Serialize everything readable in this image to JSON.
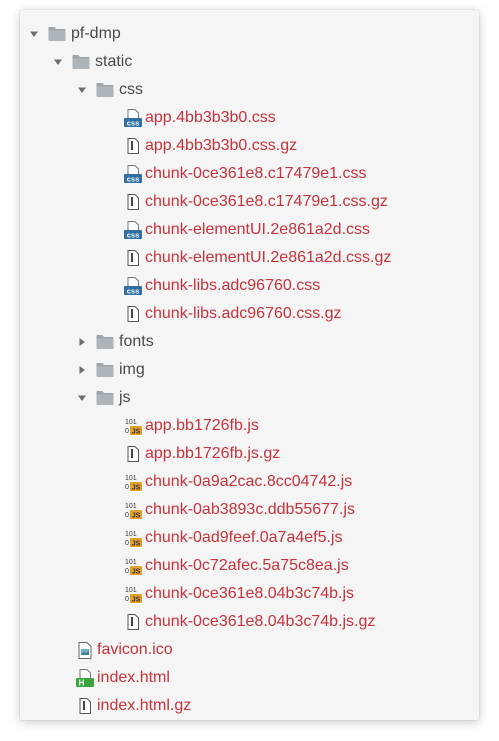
{
  "tree": {
    "root": {
      "label": "pf-dmp",
      "expanded": true
    },
    "static": {
      "label": "static",
      "expanded": true
    },
    "css": {
      "label": "css",
      "expanded": true,
      "files": [
        {
          "label": "app.4bb3b3b0.css",
          "icon": "css-file-icon"
        },
        {
          "label": "app.4bb3b3b0.css.gz",
          "icon": "generic-file-icon"
        },
        {
          "label": "chunk-0ce361e8.c17479e1.css",
          "icon": "css-file-icon"
        },
        {
          "label": "chunk-0ce361e8.c17479e1.css.gz",
          "icon": "generic-file-icon"
        },
        {
          "label": "chunk-elementUI.2e861a2d.css",
          "icon": "css-file-icon"
        },
        {
          "label": "chunk-elementUI.2e861a2d.css.gz",
          "icon": "generic-file-icon"
        },
        {
          "label": "chunk-libs.adc96760.css",
          "icon": "css-file-icon"
        },
        {
          "label": "chunk-libs.adc96760.css.gz",
          "icon": "generic-file-icon"
        }
      ]
    },
    "fonts": {
      "label": "fonts",
      "expanded": false
    },
    "img": {
      "label": "img",
      "expanded": false
    },
    "js": {
      "label": "js",
      "expanded": true,
      "files": [
        {
          "label": "app.bb1726fb.js",
          "icon": "js-file-icon"
        },
        {
          "label": "app.bb1726fb.js.gz",
          "icon": "generic-file-icon"
        },
        {
          "label": "chunk-0a9a2cac.8cc04742.js",
          "icon": "js-file-icon"
        },
        {
          "label": "chunk-0ab3893c.ddb55677.js",
          "icon": "js-file-icon"
        },
        {
          "label": "chunk-0ad9feef.0a7a4ef5.js",
          "icon": "js-file-icon"
        },
        {
          "label": "chunk-0c72afec.5a75c8ea.js",
          "icon": "js-file-icon"
        },
        {
          "label": "chunk-0ce361e8.04b3c74b.js",
          "icon": "js-file-icon"
        },
        {
          "label": "chunk-0ce361e8.04b3c74b.js.gz",
          "icon": "generic-file-icon"
        }
      ]
    },
    "static_files": [
      {
        "label": "favicon.ico",
        "icon": "image-file-icon"
      },
      {
        "label": "index.html",
        "icon": "html-file-icon"
      }
    ],
    "root_files": [
      {
        "label": "index.html.gz",
        "icon": "generic-file-icon"
      }
    ]
  },
  "colors": {
    "panel_bg": "#f5f5f5",
    "folder": "#9fa6ab",
    "folder_text": "#4a4a4a",
    "file_text": "#c7323b",
    "arrow": "#6e6e6e",
    "css_badge": "#2f6fa3",
    "js_badge": "#e2a22a",
    "html_badge": "#3aa53a"
  },
  "icon_glyphs": {
    "css_badge_text": "css",
    "js_badge_text": "JS",
    "js_bits": "101",
    "js_bit_zero": "0",
    "html_badge_text": "H"
  }
}
